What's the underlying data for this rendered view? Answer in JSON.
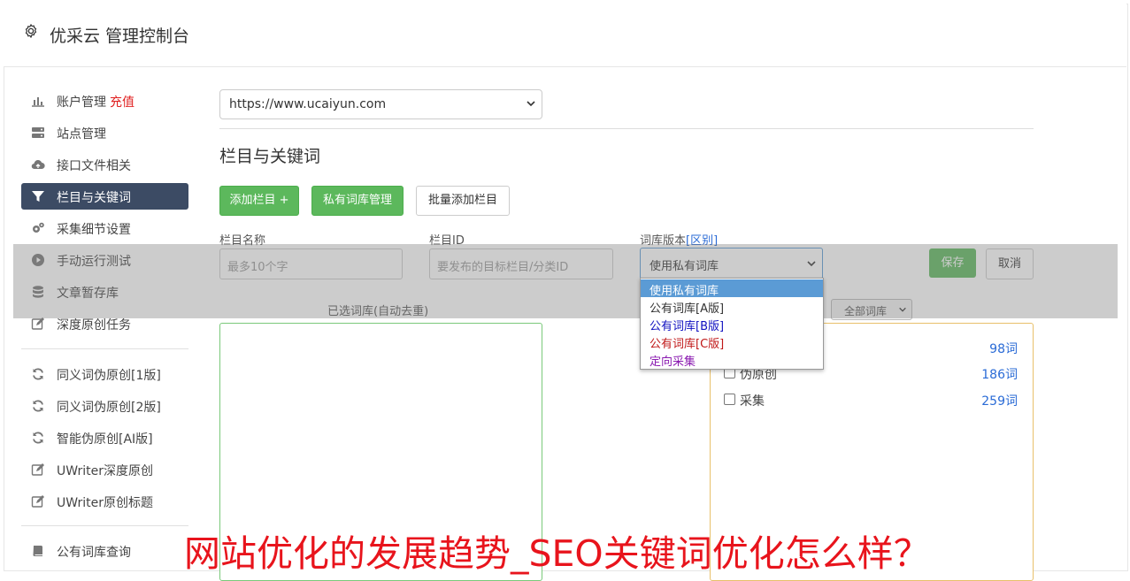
{
  "app": {
    "title": "优采云 管理控制台"
  },
  "sidebar": {
    "items": [
      {
        "label": "账户管理",
        "tag": "充值",
        "icon": "bar-chart-icon"
      },
      {
        "label": "站点管理",
        "icon": "server-icon"
      },
      {
        "label": "接口文件相关",
        "icon": "cloud-upload-icon"
      },
      {
        "label": "栏目与关键词",
        "icon": "filter-icon"
      },
      {
        "label": "采集细节设置",
        "icon": "gears-icon"
      },
      {
        "label": "手动运行测试",
        "icon": "play-icon"
      },
      {
        "label": "文章暂存库",
        "icon": "database-icon"
      },
      {
        "label": "深度原创任务",
        "icon": "edit-icon"
      },
      {
        "label": "同义词伪原创[1版]",
        "icon": "refresh-icon"
      },
      {
        "label": "同义词伪原创[2版]",
        "icon": "refresh-icon"
      },
      {
        "label": "智能伪原创[AI版]",
        "icon": "refresh-icon"
      },
      {
        "label": "UWriter深度原创",
        "icon": "edit-icon"
      },
      {
        "label": "UWriter原创标题",
        "icon": "edit-icon"
      },
      {
        "label": "公有词库查询",
        "icon": "book-icon"
      }
    ],
    "active_index": 3
  },
  "main": {
    "site_select": {
      "value": "https://www.ucaiyun.com"
    },
    "section_title": "栏目与关键词",
    "buttons": {
      "add_column": "添加栏目 +",
      "private_lib": "私有词库管理",
      "batch_add": "批量添加栏目"
    },
    "form": {
      "name_label": "栏目名称",
      "name_placeholder": "最多10个字",
      "id_label": "栏目ID",
      "id_placeholder": "要发布的目标栏目/分类ID",
      "version_label": "词库版本",
      "version_link": "[区别]",
      "version_value": "使用私有词库",
      "save": "保存",
      "cancel": "取消"
    },
    "selected_lib_label": "已选词库(自动去重)",
    "all_lib_select": "全部词库",
    "libraries": [
      {
        "name": "",
        "count": "98词"
      },
      {
        "name": "伪原创",
        "count": "186词"
      },
      {
        "name": "采集",
        "count": "259词"
      }
    ],
    "version_options": [
      {
        "label": "使用私有词库",
        "color": "#ffffff"
      },
      {
        "label": "公有词库[A版]",
        "color": "#333333"
      },
      {
        "label": "公有词库[B版]",
        "color": "#1010c0"
      },
      {
        "label": "公有词库[C版]",
        "color": "#c01818"
      },
      {
        "label": "定向采集",
        "color": "#8a1ab0"
      }
    ]
  },
  "banner": {
    "text": "网站优化的发展趋势_SEO关键词优化怎么样？"
  }
}
